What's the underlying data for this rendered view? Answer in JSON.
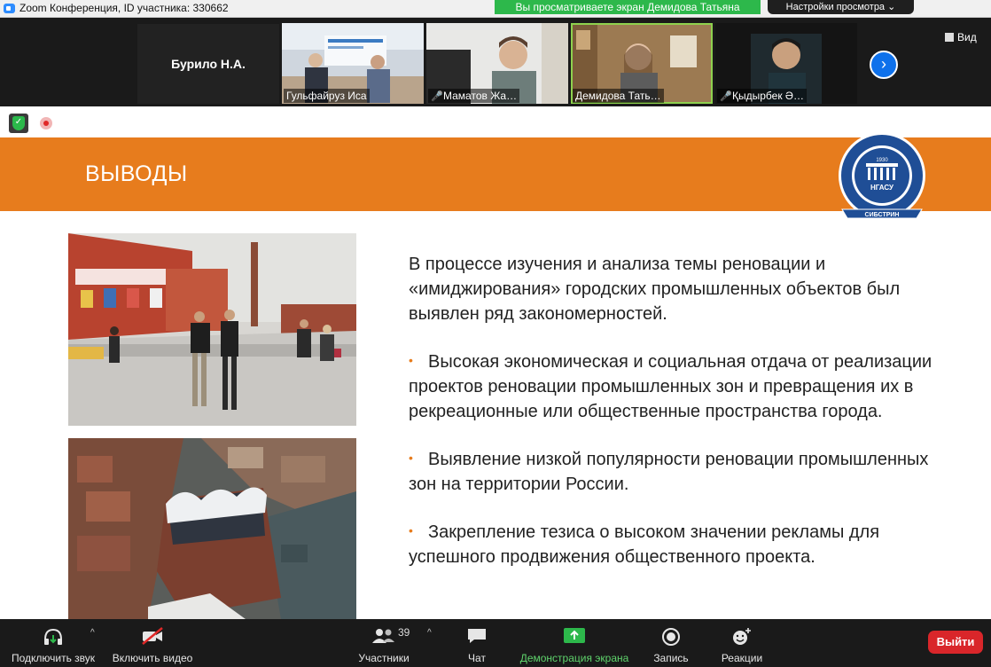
{
  "window": {
    "title": "Zoom Конференция, ID участника: 330662",
    "share_banner": "Вы просматриваете экран Демидова Татьяна",
    "view_settings": "Настройки просмотра"
  },
  "gallery": {
    "name_tile": "Бурило Н.А.",
    "tiles": [
      {
        "label": "Гульфайруз Иса",
        "muted": false
      },
      {
        "label": "Маматов Жа…",
        "muted": true
      },
      {
        "label": "Демидова Тать…",
        "muted": false
      },
      {
        "label": "Қыдырбек Ә…",
        "muted": true
      }
    ],
    "view_label": "Вид"
  },
  "slide": {
    "title": "ВЫВОДЫ",
    "logo_text": {
      "year": "1930",
      "short": "НГАСУ",
      "ribbon": "СИБСТРИН"
    },
    "intro": "В процессе изучения и анализа темы реновации и «имиджирования» городских промышленных объектов был выявлен ряд закономерностей.",
    "bullets": [
      "Высокая экономическая и социальная отдача от реализации проектов реновации промышленных зон и превращения их в рекреационные или общественные пространства города.",
      "Выявление низкой популярности реновации промышленных зон на территории России.",
      "Закрепление тезиса о высоком значении рекламы для успешного продвижения общественного проекта."
    ]
  },
  "toolbar": {
    "audio": "Подключить звук",
    "video": "Включить видео",
    "participants": "Участники",
    "participants_count": "39",
    "chat": "Чат",
    "share": "Демонстрация экрана",
    "record": "Запись",
    "reactions": "Реакции",
    "leave": "Выйти"
  },
  "colors": {
    "accent": "#e77c1d",
    "share_green": "#2db84b",
    "leave_red": "#d9262a"
  }
}
